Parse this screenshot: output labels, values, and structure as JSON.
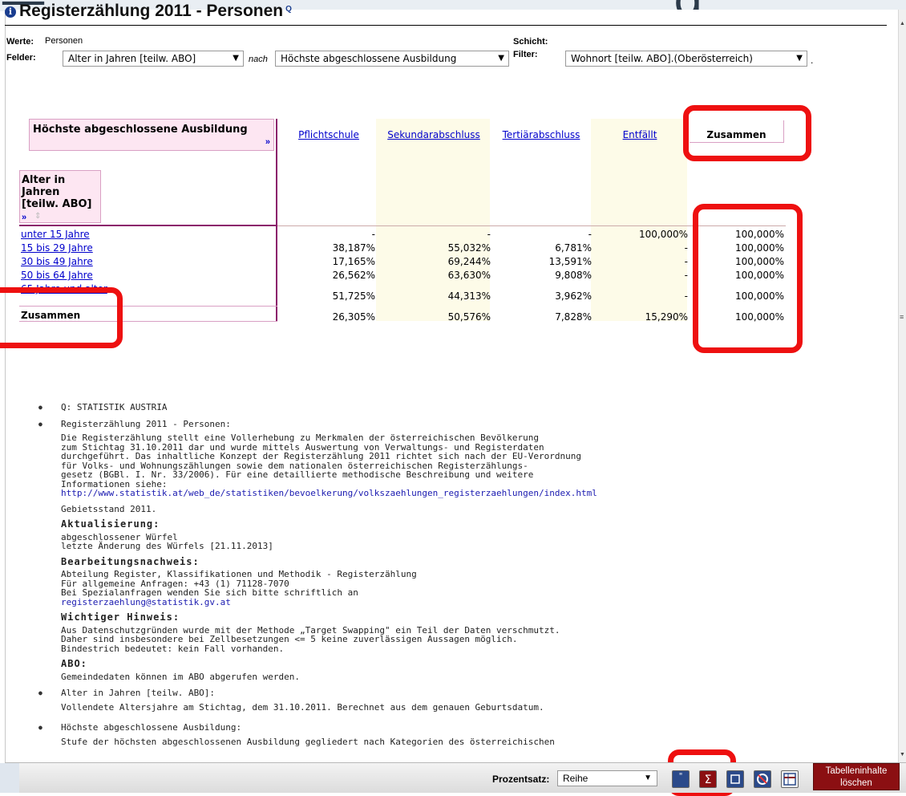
{
  "page": {
    "title": "Registerzählung 2011 - Personen",
    "title_suffix": "Q"
  },
  "controls": {
    "werte_label": "Werte:",
    "werte_value": "Personen",
    "schicht_label": "Schicht:",
    "felder_label": "Felder:",
    "field1": "Alter in Jahren [teilw. ABO]",
    "nach": "nach",
    "field2": "Höchste abgeschlossene Ausbildung",
    "filter_label": "Filter:",
    "filter_value": "Wohnort [teilw. ABO].(Oberösterreich)",
    "filter_end": "."
  },
  "table": {
    "col_dim_label": "Höchste abgeschlossene Ausbildung",
    "col_dim_more": "»",
    "row_dim_label": "Alter in Jahren [teilw. ABO]",
    "row_dim_more": "»",
    "row_dim_sort": "⇕",
    "columns": [
      "Pflichtschule",
      "Sekundarabschluss",
      "Tertiärabschluss",
      "Entfällt"
    ],
    "total_col": "Zusammen",
    "rows": [
      {
        "label": "unter 15 Jahre",
        "values": [
          "-",
          "-",
          "-",
          "100,000%"
        ],
        "total": "100,000%"
      },
      {
        "label": "15 bis 29 Jahre",
        "values": [
          "38,187%",
          "55,032%",
          "6,781%",
          "-"
        ],
        "total": "100,000%"
      },
      {
        "label": "30 bis 49 Jahre",
        "values": [
          "17,165%",
          "69,244%",
          "13,591%",
          "-"
        ],
        "total": "100,000%"
      },
      {
        "label": "50 bis 64 Jahre",
        "values": [
          "26,562%",
          "63,630%",
          "9,808%",
          "-"
        ],
        "total": "100,000%"
      },
      {
        "label": "65 Jahre und alter",
        "values": [
          "51,725%",
          "44,313%",
          "3,962%",
          "-"
        ],
        "total": "100,000%"
      }
    ],
    "total_row": {
      "label": "Zusammen",
      "values": [
        "26,305%",
        "50,576%",
        "7,828%",
        "15,290%"
      ],
      "total": "100,000%"
    }
  },
  "notes": {
    "q": "Q: STATISTIK AUSTRIA",
    "reg_title": "Registerzählung 2011 - Personen:",
    "reg_text": "Die Registerzählung stellt eine Vollerhebung zu Merkmalen der österreichischen Bevölkerung\nzum Stichtag 31.10.2011 dar und wurde mittels Auswertung von Verwaltungs- und Registerdaten\ndurchgeführt. Das inhaltliche Konzept der Registerzählung 2011 richtet sich nach der EU-Verordnung\nfür Volks- und Wohnungszählungen sowie dem nationalen österreichischen Registerzählungs-\ngesetz (BGBl. I. Nr. 33/2006). Für eine detaillierte methodische Beschreibung und weitere\nInformationen siehe:",
    "reg_link": "http://www.statistik.at/web_de/statistiken/bevoelkerung/volkszaehlungen_registerzaehlungen/index.html",
    "gebiet": "Gebietsstand 2011.",
    "akt_h": "Aktualisierung:",
    "akt_text": "abgeschlossener Würfel\nletzte Änderung des Würfels   [21.11.2013]",
    "bear_h": "Bearbeitungsnachweis:",
    "bear_text": "Abteilung Register, Klassifikationen und Methodik - Registerzählung\nFür allgemeine Anfragen: +43 (1) 71128-7070\nBei Spezialanfragen wenden Sie sich bitte schriftlich an",
    "bear_mail": "registerzaehlung@statistik.gv.at",
    "wicht_h": "Wichtiger Hinweis:",
    "wicht_text": "Aus Datenschutzgründen wurde mit der Methode „Target Swapping\" ein Teil der Daten verschmutzt.\nDaher sind insbesondere bei Zellbesetzungen <= 5 keine zuverlässigen Aussagen möglich.\nBindestrich bedeutet: kein Fall vorhanden.",
    "abo_h": "ABO:",
    "abo_text": "Gemeindedaten können im ABO abgerufen werden.",
    "alter_title": "Alter in Jahren [teilw. ABO]:",
    "alter_text": "Vollendete Altersjahre am Stichtag, dem 31.10.2011. Berechnet aus dem genauen Geburtsdatum.",
    "ausb_title": "Höchste abgeschlossene Ausbildung:",
    "ausb_text": "Stufe der höchsten abgeschlossenen Ausbildung gegliedert nach Kategorien des österreichischen"
  },
  "footer": {
    "pct_label": "Prozentsatz:",
    "pct_value": "Reihe",
    "clear_button": "Tabelleninhalte löschen"
  },
  "colors": {
    "accent": "#8b1a6b",
    "highlight": "#ee1010",
    "link": "#0000cc",
    "clear_button": "#8b0f12"
  }
}
